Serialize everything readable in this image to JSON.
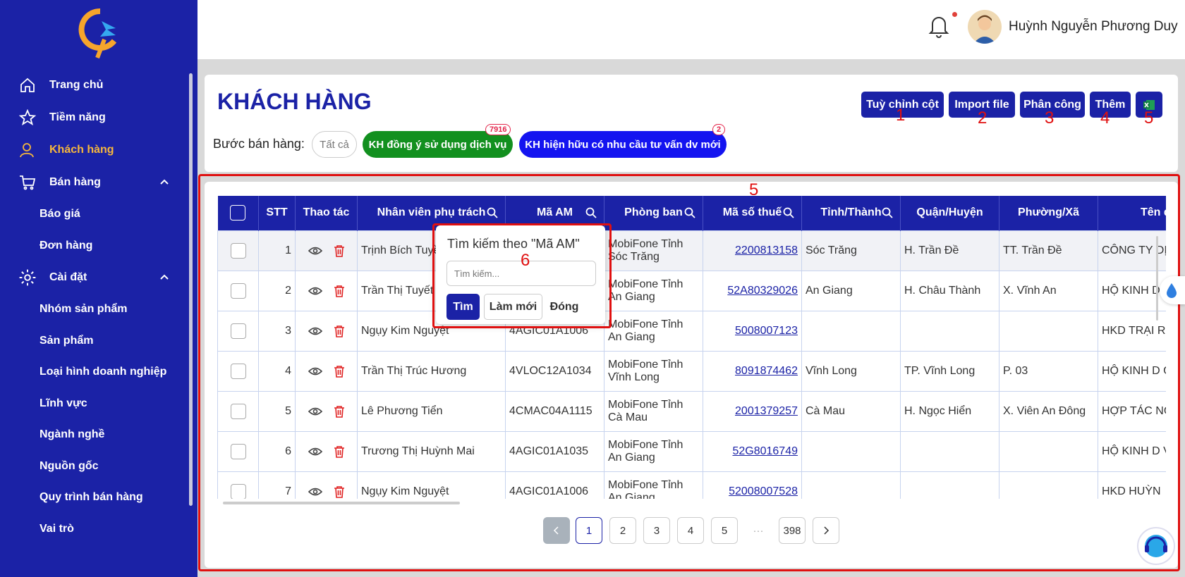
{
  "user": {
    "name": "Huỳnh Nguyễn Phương Duy"
  },
  "sidebar": {
    "items": [
      {
        "label": "Trang chủ"
      },
      {
        "label": "Tiềm năng"
      },
      {
        "label": "Khách hàng"
      },
      {
        "label": "Bán hàng"
      },
      {
        "label": "Báo giá"
      },
      {
        "label": "Đơn hàng"
      },
      {
        "label": "Cài đặt"
      },
      {
        "label": "Nhóm sản phẩm"
      },
      {
        "label": "Sản phẩm"
      },
      {
        "label": "Loại hình doanh nghiệp"
      },
      {
        "label": "Lĩnh vực"
      },
      {
        "label": "Ngành nghề"
      },
      {
        "label": "Nguồn gốc"
      },
      {
        "label": "Quy trình bán hàng"
      },
      {
        "label": "Vai trò"
      }
    ]
  },
  "page": {
    "title": "KHÁCH HÀNG",
    "step_label": "Bước bán hàng:",
    "filters": [
      {
        "label": "Tất cả"
      },
      {
        "label": "KH đồng ý sử dụng dịch vụ",
        "count": "7916"
      },
      {
        "label": "KH hiện hữu có nhu cầu tư vấn dv mới",
        "count": "2"
      }
    ],
    "buttons": {
      "customize": "Tuỳ chỉnh cột",
      "import": "Import file",
      "assign": "Phân công",
      "add": "Thêm"
    }
  },
  "annotations": [
    "1",
    "2",
    "3",
    "4",
    "5",
    "5",
    "6"
  ],
  "table": {
    "columns": [
      "STT",
      "Thao tác",
      "Nhân viên phụ trách",
      "Mã AM",
      "Phòng ban",
      "Mã số thuế",
      "Tỉnh/Thành",
      "Quận/Huyện",
      "Phường/Xã",
      "Tên doa"
    ],
    "rows": [
      {
        "stt": "1",
        "staff": "Trịnh Bích Tuyền",
        "am": "",
        "dept": "MobiFone Tỉnh Sóc Trăng",
        "tax": "2200813158",
        "province": "Sóc Trăng",
        "district": "H. Trần Đề",
        "ward": "TT. Trần Đề",
        "name": "CÔNG TY DỊCH VỤ T"
      },
      {
        "stt": "2",
        "staff": "Trần Thị Tuyết H",
        "am": "",
        "dept": "MobiFone Tỉnh An Giang",
        "tax": "52A80329026",
        "province": "An Giang",
        "district": "H. Châu Thành",
        "ward": "X. Vĩnh An",
        "name": "HỘ KINH D"
      },
      {
        "stt": "3",
        "staff": "Ngụy Kim Nguyệt",
        "am": "4AGIC01A1006",
        "dept": "MobiFone Tỉnh An Giang",
        "tax": "5008007123",
        "province": "",
        "district": "",
        "ward": "",
        "name": "HKD TRẠI RỪNG TRÀ"
      },
      {
        "stt": "4",
        "staff": "Trần Thị Trúc Hương",
        "am": "4VLOC12A1034",
        "dept": "MobiFone Tỉnh Vĩnh Long",
        "tax": "8091874462",
        "province": "Vĩnh Long",
        "district": "TP. Vĩnh Long",
        "ward": "P. 03",
        "name": "HỘ KINH D GẠCH"
      },
      {
        "stt": "5",
        "staff": "Lê Phương Tiển",
        "am": "4CMAC04A1115",
        "dept": "MobiFone Tỉnh Cà Mau",
        "tax": "2001379257",
        "province": "Cà Mau",
        "district": "H. Ngọc Hiển",
        "ward": "X. Viên An Đông",
        "name": "HỢP TÁC NGHIỆP V"
      },
      {
        "stt": "6",
        "staff": "Trương Thị Huỳnh Mai",
        "am": "4AGIC01A1035",
        "dept": "MobiFone Tỉnh An Giang",
        "tax": "52G8016749",
        "province": "",
        "district": "",
        "ward": "",
        "name": "HỘ KINH D VĂN KHU"
      },
      {
        "stt": "7",
        "staff": "Ngụy Kim Nguyệt",
        "am": "4AGIC01A1006",
        "dept": "MobiFone Tỉnh An Giang",
        "tax": "52008007528",
        "province": "",
        "district": "",
        "ward": "",
        "name": "HKD HUỲN"
      }
    ]
  },
  "pagination": {
    "pages": [
      "1",
      "2",
      "3",
      "4",
      "5"
    ],
    "dots": "···",
    "last": "398"
  },
  "popup": {
    "title": "Tìm kiếm theo \"Mã AM\"",
    "placeholder": "Tìm kiếm...",
    "search_btn": "Tìm",
    "reset_btn": "Làm mới",
    "close_btn": "Đóng"
  }
}
